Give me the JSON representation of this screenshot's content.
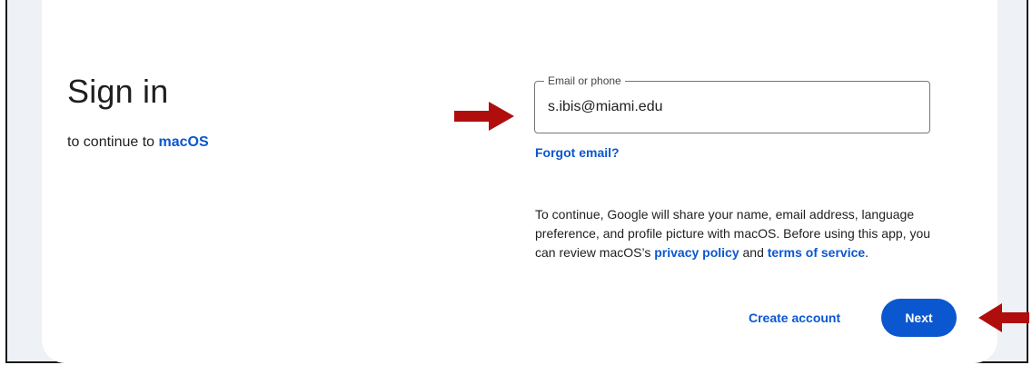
{
  "header": {
    "title": "Sign in",
    "subtitle_prefix": "to continue to ",
    "subtitle_app": "macOS"
  },
  "email_field": {
    "label": "Email or phone",
    "value": "s.ibis@miami.edu"
  },
  "forgot_email": "Forgot email?",
  "info": {
    "part1": "To continue, Google will share your name, email address, language preference, and profile picture with macOS. Before using this app, you can review macOS’s ",
    "privacy_link": "privacy policy",
    "middle": " and ",
    "terms_link": "terms of service",
    "end": "."
  },
  "actions": {
    "create_account": "Create account",
    "next": "Next"
  },
  "annotation_color": "#b00d0d",
  "accent_color": "#0b57d0"
}
